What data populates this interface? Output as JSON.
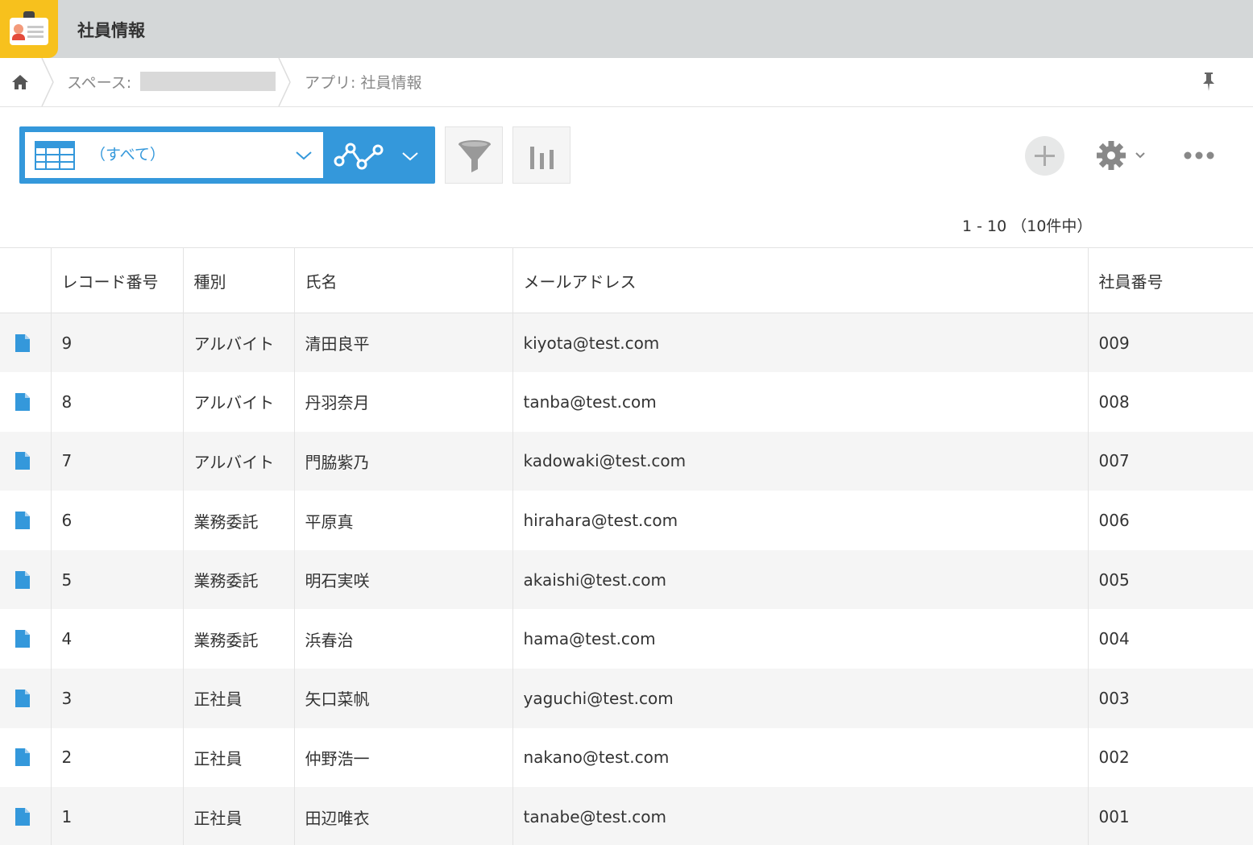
{
  "header": {
    "title": "社員情報"
  },
  "breadcrumb": {
    "space_label": "スペース:",
    "app_label": "アプリ: 社員情報"
  },
  "toolbar": {
    "view_selected": "（すべて）"
  },
  "pager": {
    "text": "1 - 10 （10件中）"
  },
  "table": {
    "columns": [
      "レコード番号",
      "種別",
      "氏名",
      "メールアドレス",
      "社員番号"
    ],
    "rows": [
      [
        "9",
        "アルバイト",
        "清田良平",
        "kiyota@test.com",
        "009"
      ],
      [
        "8",
        "アルバイト",
        "丹羽奈月",
        "tanba@test.com",
        "008"
      ],
      [
        "7",
        "アルバイト",
        "門脇紫乃",
        "kadowaki@test.com",
        "007"
      ],
      [
        "6",
        "業務委託",
        "平原真",
        "hirahara@test.com",
        "006"
      ],
      [
        "5",
        "業務委託",
        "明石実咲",
        "akaishi@test.com",
        "005"
      ],
      [
        "4",
        "業務委託",
        "浜春治",
        "hama@test.com",
        "004"
      ],
      [
        "3",
        "正社員",
        "矢口菜帆",
        "yaguchi@test.com",
        "003"
      ],
      [
        "2",
        "正社員",
        "仲野浩一",
        "nakano@test.com",
        "002"
      ],
      [
        "1",
        "正社員",
        "田辺唯衣",
        "tanabe@test.com",
        "001"
      ]
    ]
  },
  "colors": {
    "accent": "#3498db",
    "app_icon": "#f7c11d",
    "header_bg": "#d4d7d8",
    "row_alt": "#f5f5f5"
  },
  "icons": [
    "app-icon",
    "home-icon",
    "pin-icon",
    "table-icon",
    "graph-icon",
    "filter-icon",
    "bar-chart-icon",
    "plus-icon",
    "gear-icon",
    "more-icon",
    "document-icon"
  ]
}
